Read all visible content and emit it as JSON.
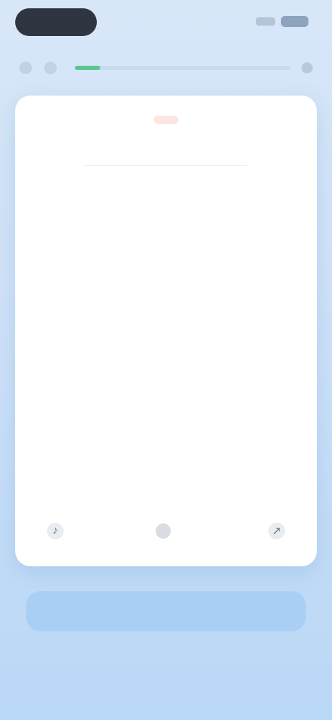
{
  "status_bar": {
    "time_pill": ""
  },
  "progress": {
    "value": 0.12
  },
  "card": {
    "badge": "",
    "term": "",
    "definition": "",
    "flip_hint": ""
  },
  "actions": {
    "primary_label": "",
    "secondary_label": ""
  },
  "icons": {
    "back": "chevron-left-icon",
    "menu": "more-icon",
    "close": "close-icon",
    "flip": "flip-icon",
    "audio": "speaker-icon"
  },
  "colors": {
    "accent": "#5cc690",
    "badge_text": "#e25b45",
    "primary_button": "#a9d0f4"
  }
}
